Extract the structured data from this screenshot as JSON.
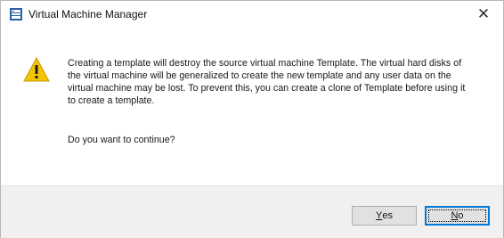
{
  "window": {
    "title": "Virtual Machine Manager",
    "icon": "vmm-app-icon",
    "close_label": "✕"
  },
  "message": {
    "lines": [
      "Creating a template will destroy the source virtual machine Template. The virtual hard disks of",
      "the virtual machine will be generalized to create the new template and any user data on the",
      "virtual machine may be lost. To prevent this, you can create a clone of Template before using it",
      "to create a template."
    ],
    "question": "Do you want to continue?",
    "icon": "warning-icon"
  },
  "buttons": {
    "yes": {
      "mnemonic": "Y",
      "rest": "es"
    },
    "no": {
      "mnemonic": "N",
      "rest": "o"
    }
  },
  "colors": {
    "warning_fill": "#f5c400",
    "focus_border": "#0078d7",
    "footer_bg": "#f0f0f0"
  }
}
